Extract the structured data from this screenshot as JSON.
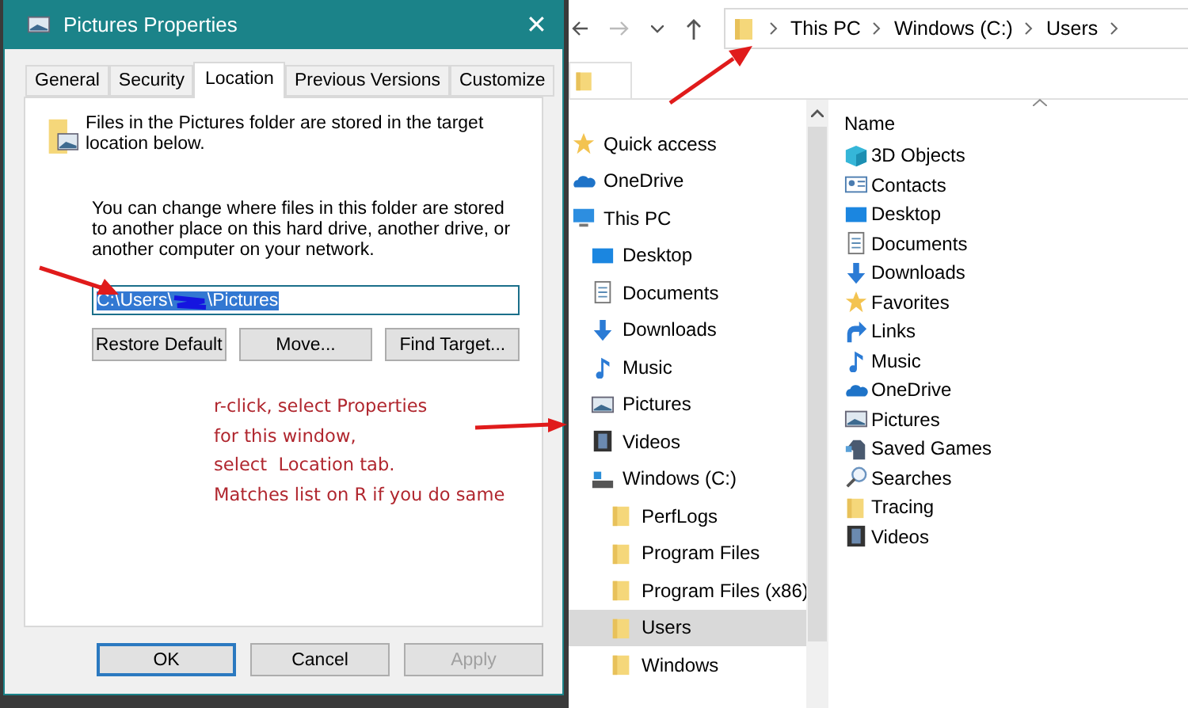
{
  "dialog": {
    "title": "Pictures Properties",
    "close": "✕",
    "tabs": [
      {
        "label": "General",
        "selected": false
      },
      {
        "label": "Security",
        "selected": false
      },
      {
        "label": "Location",
        "selected": true
      },
      {
        "label": "Previous Versions",
        "selected": false
      },
      {
        "label": "Customize",
        "selected": false
      }
    ],
    "description": "Files in the Pictures folder are stored in the target location below.",
    "info": "You can change where files in this folder are stored to another place on this hard drive, another drive, or another computer on your network.",
    "path_field": {
      "value_start": "C:\\Users\\",
      "value_end": "\\Pictures"
    },
    "actions": [
      "Restore Default",
      "Move...",
      "Find Target..."
    ],
    "footer_buttons": [
      {
        "label": "OK",
        "default": true,
        "disabled": false
      },
      {
        "label": "Cancel",
        "default": false,
        "disabled": false
      },
      {
        "label": "Apply",
        "default": false,
        "disabled": true
      }
    ]
  },
  "annotation": [
    "r-click, select Properties",
    "for this window,",
    "select  Location tab.",
    "Matches list on R if you do same"
  ],
  "explorer": {
    "breadcrumb": [
      "This PC",
      "Windows (C:)",
      "Users"
    ],
    "nav": [
      {
        "label": "Quick access",
        "kind": "star",
        "selected": false
      },
      {
        "label": "OneDrive",
        "kind": "cloud",
        "selected": false
      },
      {
        "label": "This PC",
        "kind": "pc",
        "selected": false,
        "children": [
          {
            "label": "Desktop",
            "kind": "desktop",
            "selected": false
          },
          {
            "label": "Documents",
            "kind": "document",
            "selected": false
          },
          {
            "label": "Downloads",
            "kind": "download",
            "selected": false
          },
          {
            "label": "Music",
            "kind": "music",
            "selected": false
          },
          {
            "label": "Pictures",
            "kind": "picture",
            "selected": false
          },
          {
            "label": "Videos",
            "kind": "video",
            "selected": false
          },
          {
            "label": "Windows (C:)",
            "kind": "drive",
            "selected": false,
            "children": [
              {
                "label": "PerfLogs",
                "kind": "folder",
                "selected": false
              },
              {
                "label": "Program Files",
                "kind": "folder",
                "selected": false
              },
              {
                "label": "Program Files (x86)",
                "kind": "folder",
                "selected": false
              },
              {
                "label": "Users",
                "kind": "folder",
                "selected": true
              },
              {
                "label": "Windows",
                "kind": "folder",
                "selected": false
              }
            ]
          }
        ]
      }
    ],
    "column": "Name",
    "files": [
      {
        "label": "3D Objects",
        "kind": "cube"
      },
      {
        "label": "Contacts",
        "kind": "contact"
      },
      {
        "label": "Desktop",
        "kind": "desktop"
      },
      {
        "label": "Documents",
        "kind": "document"
      },
      {
        "label": "Downloads",
        "kind": "download"
      },
      {
        "label": "Favorites",
        "kind": "star"
      },
      {
        "label": "Links",
        "kind": "link"
      },
      {
        "label": "Music",
        "kind": "music"
      },
      {
        "label": "OneDrive",
        "kind": "cloud"
      },
      {
        "label": "Pictures",
        "kind": "picture"
      },
      {
        "label": "Saved Games",
        "kind": "game"
      },
      {
        "label": "Searches",
        "kind": "search"
      },
      {
        "label": "Tracing",
        "kind": "folder"
      },
      {
        "label": "Videos",
        "kind": "video"
      }
    ]
  }
}
